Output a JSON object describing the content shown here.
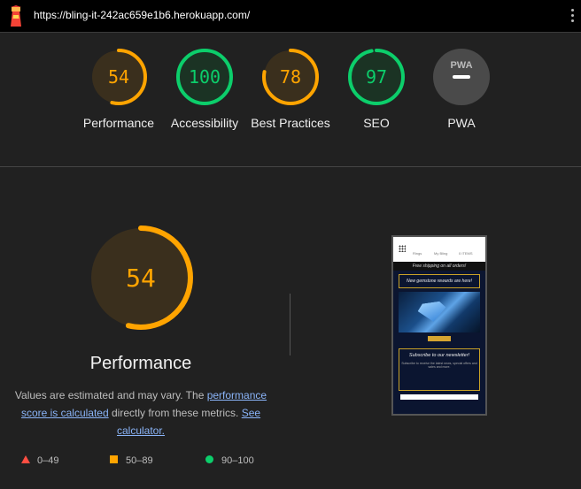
{
  "topbar": {
    "url": "https://bling-it-242ac659e1b6.herokuapp.com/"
  },
  "colors": {
    "orange": "#ffa400",
    "green": "#0cce6b",
    "red": "#ff4e42",
    "gray": "#4a4a4a"
  },
  "gauges": [
    {
      "label": "Performance",
      "score": "54",
      "value": 54,
      "color": "#ffa400",
      "bg": "#3a2f1d"
    },
    {
      "label": "Accessibility",
      "score": "100",
      "value": 100,
      "color": "#0cce6b",
      "bg": "#1b3324"
    },
    {
      "label": "Best Practices",
      "score": "78",
      "value": 78,
      "color": "#ffa400",
      "bg": "#3a2f1d"
    },
    {
      "label": "SEO",
      "score": "97",
      "value": 97,
      "color": "#0cce6b",
      "bg": "#1b3324"
    },
    {
      "label": "PWA",
      "badge": "PWA"
    }
  ],
  "main": {
    "score": "54",
    "value": 54,
    "title": "Performance",
    "desc_pre": "Values are estimated and may vary. The ",
    "desc_link1": "performance score is calculated",
    "desc_mid": " directly from these metrics. ",
    "desc_link2": "See calculator."
  },
  "legend": [
    {
      "range": "0–49",
      "shape": "triangle",
      "color": "#ff4e42"
    },
    {
      "range": "50–89",
      "shape": "square",
      "color": "#ffa400"
    },
    {
      "range": "90–100",
      "shape": "circle",
      "color": "#0cce6b"
    }
  ],
  "screenshot": {
    "nav": [
      "Rings",
      "My Bling",
      "0 ITEMS"
    ],
    "bar": "Free shipping on all orders!",
    "banner": "New gemstone rewards are here!",
    "sub_title": "Subscribe to our newsletter!",
    "sub_text": "Subscribe to receive the latest news, special offers and sales and more."
  }
}
